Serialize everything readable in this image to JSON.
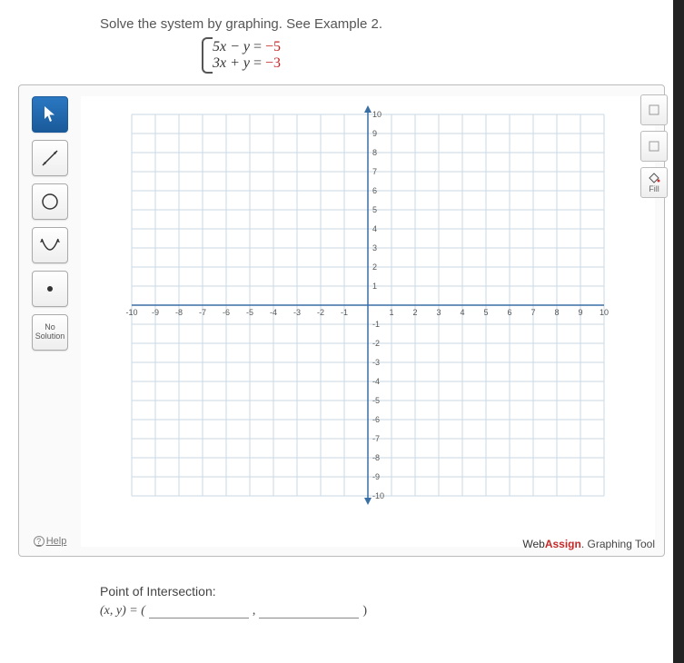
{
  "instruction": "Solve the system by graphing. See Example 2.",
  "equations": {
    "eq1_lhs": "5x − y",
    "eq1_eq": " = ",
    "eq1_rhs": "−5",
    "eq2_lhs": "3x + y",
    "eq2_eq": " = ",
    "eq2_rhs": "−3"
  },
  "toolbar": {
    "no_solution_l1": "No",
    "no_solution_l2": "Solution",
    "help": "Help"
  },
  "right_tools": {
    "fill": "Fill"
  },
  "brand": {
    "prefix": "Web",
    "bold": "Assign",
    "suffix": ". Graphing Tool"
  },
  "answer": {
    "heading": "Point of Intersection:",
    "label": "(x, y) = (",
    "comma": ",",
    "close": ")"
  },
  "chart_data": {
    "type": "scatter",
    "title": "",
    "xlabel": "",
    "ylabel": "",
    "xlim": [
      -10,
      10
    ],
    "ylim": [
      -10,
      10
    ],
    "x_ticks": [
      -10,
      -9,
      -8,
      -7,
      -6,
      -5,
      -4,
      -3,
      -2,
      -1,
      1,
      2,
      3,
      4,
      5,
      6,
      7,
      8,
      9,
      10
    ],
    "y_ticks": [
      -10,
      -9,
      -8,
      -7,
      -6,
      -5,
      -4,
      -3,
      -2,
      -1,
      1,
      2,
      3,
      4,
      5,
      6,
      7,
      8,
      9,
      10
    ],
    "series": []
  }
}
